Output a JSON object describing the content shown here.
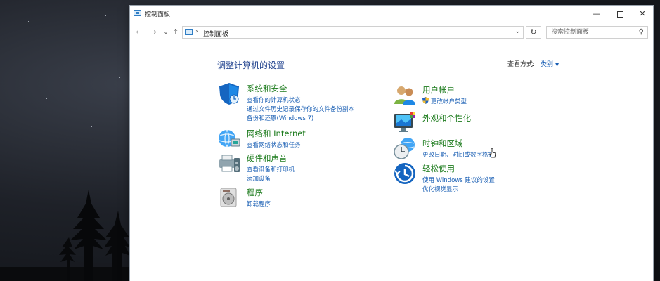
{
  "window": {
    "title": "控制面板"
  },
  "address_bar": {
    "crumb": "控制面板"
  },
  "search": {
    "placeholder": "搜索控制面板"
  },
  "main": {
    "heading": "调整计算机的设置",
    "view_by_label": "查看方式:",
    "view_by_value": "类别"
  },
  "categories_left": [
    {
      "title": "系统和安全",
      "icon": "shield-security-icon",
      "links": [
        "查看你的计算机状态",
        "通过文件历史记录保存你的文件备份副本",
        "备份和还原(Windows 7)"
      ]
    },
    {
      "title": "网络和 Internet",
      "icon": "network-globe-icon",
      "links": [
        "查看网络状态和任务"
      ]
    },
    {
      "title": "硬件和声音",
      "icon": "printer-speaker-icon",
      "links": [
        "查看设备和打印机",
        "添加设备"
      ]
    },
    {
      "title": "程序",
      "icon": "programs-disk-icon",
      "links": [
        "卸载程序"
      ]
    }
  ],
  "categories_right": [
    {
      "title": "用户帐户",
      "icon": "users-icon",
      "links": [
        "更改帐户类型"
      ]
    },
    {
      "title": "外观和个性化",
      "icon": "monitor-palette-icon",
      "links": []
    },
    {
      "title": "时钟和区域",
      "icon": "clock-globe-icon",
      "links": [
        "更改日期、时间或数字格式"
      ]
    },
    {
      "title": "轻松使用",
      "icon": "ease-of-access-icon",
      "links": [
        "使用 Windows 建议的设置",
        "优化视觉显示"
      ]
    }
  ],
  "colors": {
    "heading": "#1d3f8c",
    "category_title": "#1c7b1c",
    "link": "#1a5fb4"
  }
}
